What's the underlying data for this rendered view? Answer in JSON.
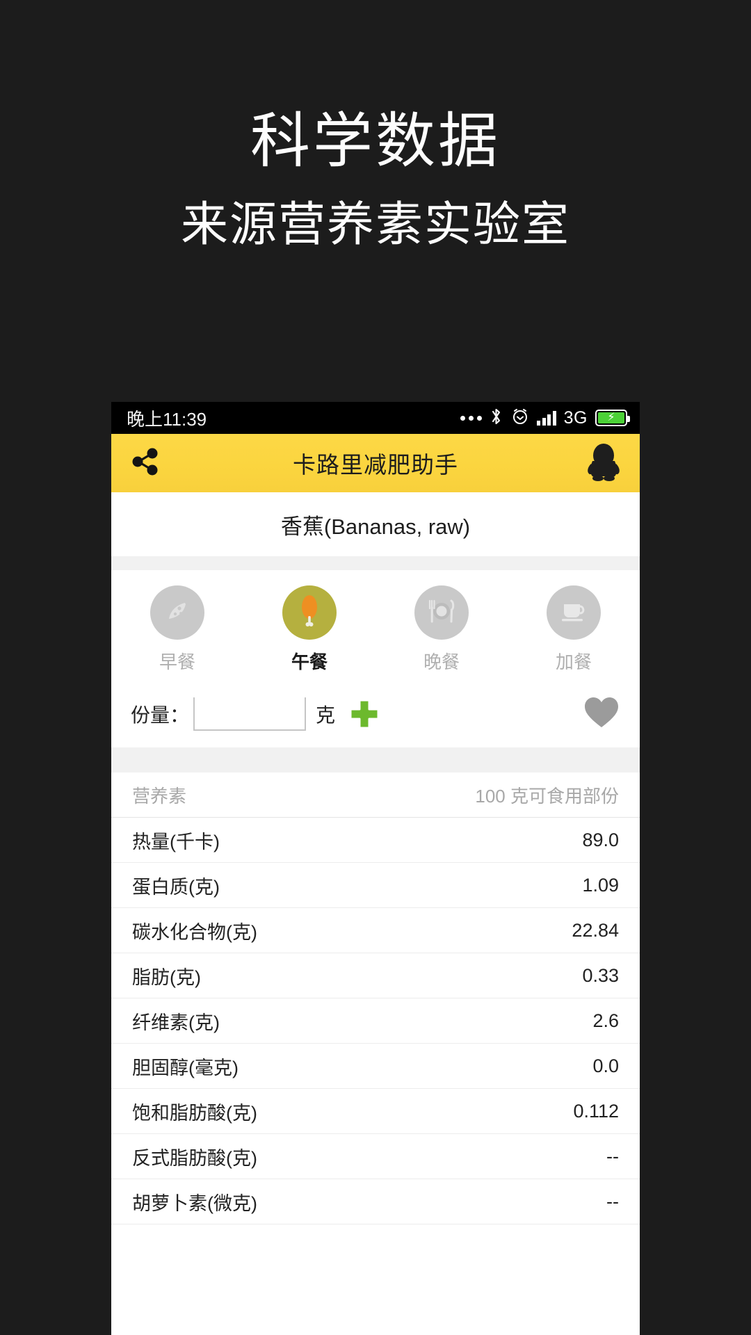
{
  "promo": {
    "title": "科学数据",
    "subtitle": "来源营养素实验室"
  },
  "statusbar": {
    "time": "晚上11:39",
    "network": "3G",
    "icons": [
      "more-dots-icon",
      "bluetooth-icon",
      "alarm-clock-icon",
      "signal-bars-icon",
      "battery-charging-icon"
    ]
  },
  "appbar": {
    "title": "卡路里减肥助手",
    "share_icon": "share-icon",
    "profile_icon": "qq-penguin-icon",
    "bg_color": "#fbd53f"
  },
  "food": {
    "title": "香蕉(Bananas, raw)"
  },
  "meals": [
    {
      "label": "早餐",
      "icon": "pizza-slice-icon",
      "selected": false
    },
    {
      "label": "午餐",
      "icon": "chicken-drumstick-icon",
      "selected": true
    },
    {
      "label": "晚餐",
      "icon": "plate-cutlery-icon",
      "selected": false
    },
    {
      "label": "加餐",
      "icon": "coffee-cup-icon",
      "selected": false
    }
  ],
  "portion": {
    "label": "份量：",
    "value": "",
    "placeholder": "",
    "unit": "克",
    "add_icon": "plus-icon",
    "add_color": "#6cb92d",
    "favorite_icon": "heart-icon",
    "favorite_color": "#9b9b9b"
  },
  "nutrition": {
    "header": {
      "name": "营养素",
      "value": "100 克可食用部份"
    },
    "rows": [
      {
        "name": "热量(千卡)",
        "value": "89.0"
      },
      {
        "name": "蛋白质(克)",
        "value": "1.09"
      },
      {
        "name": "碳水化合物(克)",
        "value": "22.84"
      },
      {
        "name": "脂肪(克)",
        "value": "0.33"
      },
      {
        "name": "纤维素(克)",
        "value": "2.6"
      },
      {
        "name": "胆固醇(毫克)",
        "value": "0.0"
      },
      {
        "name": "饱和脂肪酸(克)",
        "value": "0.112"
      },
      {
        "name": "反式脂肪酸(克)",
        "value": "--"
      },
      {
        "name": "胡萝卜素(微克)",
        "value": "--"
      }
    ]
  }
}
